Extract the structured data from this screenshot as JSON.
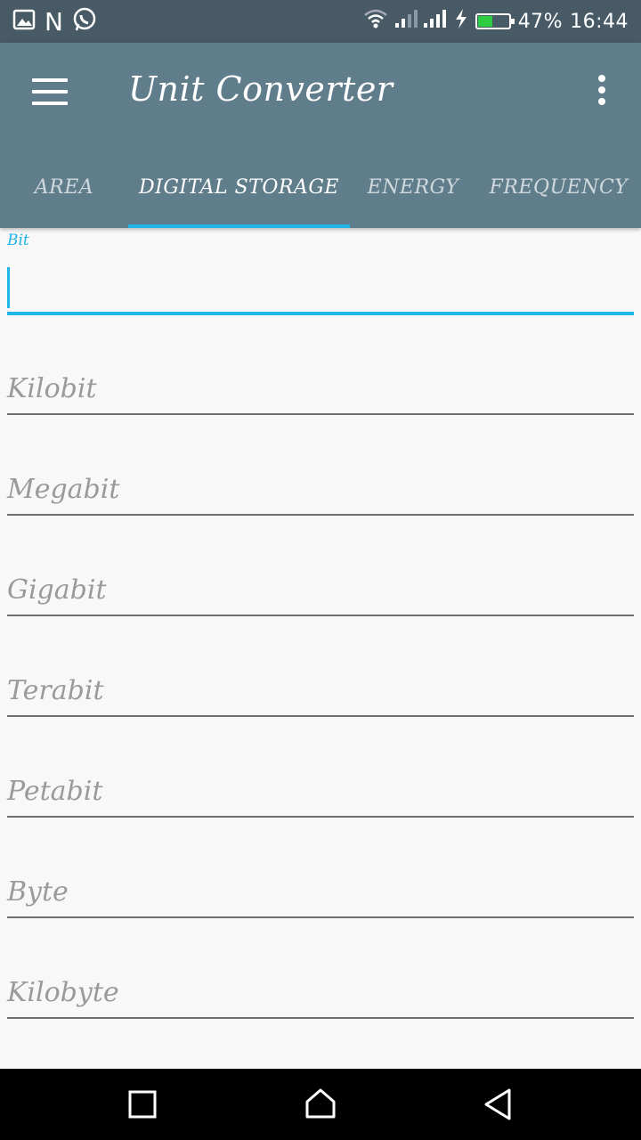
{
  "status_bar": {
    "carrier_letter": "N",
    "battery_percent": "47%",
    "battery_level": 0.47,
    "time": "16:44",
    "icons": [
      "image-icon",
      "whatsapp-icon",
      "wifi-icon",
      "signal-icon",
      "charging-icon",
      "battery-icon"
    ]
  },
  "app_bar": {
    "title": "Unit Converter"
  },
  "tabs": [
    {
      "label": "AREA",
      "active": false
    },
    {
      "label": "DIGITAL STORAGE",
      "active": true
    },
    {
      "label": "ENERGY",
      "active": false
    },
    {
      "label": "FREQUENCY",
      "active": false
    }
  ],
  "fields": {
    "active": {
      "label": "Bit",
      "value": ""
    },
    "items": [
      {
        "label": "Kilobit"
      },
      {
        "label": "Megabit"
      },
      {
        "label": "Gigabit"
      },
      {
        "label": "Terabit"
      },
      {
        "label": "Petabit"
      },
      {
        "label": "Byte"
      },
      {
        "label": "Kilobyte"
      }
    ]
  },
  "colors": {
    "accent": "#1fb5e8",
    "app_bar": "#607d8b",
    "status_bar": "#475a66"
  }
}
